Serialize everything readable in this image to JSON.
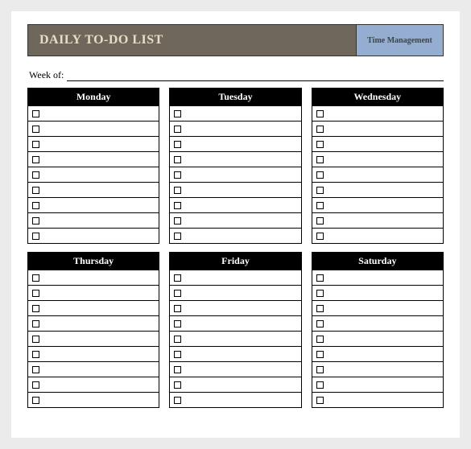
{
  "header": {
    "title": "DAILY TO-DO LIST",
    "tag": "Time Management"
  },
  "week_of_label": "Week of:",
  "days": [
    "Monday",
    "Tuesday",
    "Wednesday",
    "Thursday",
    "Friday",
    "Saturday"
  ],
  "rows_per_day": 9
}
